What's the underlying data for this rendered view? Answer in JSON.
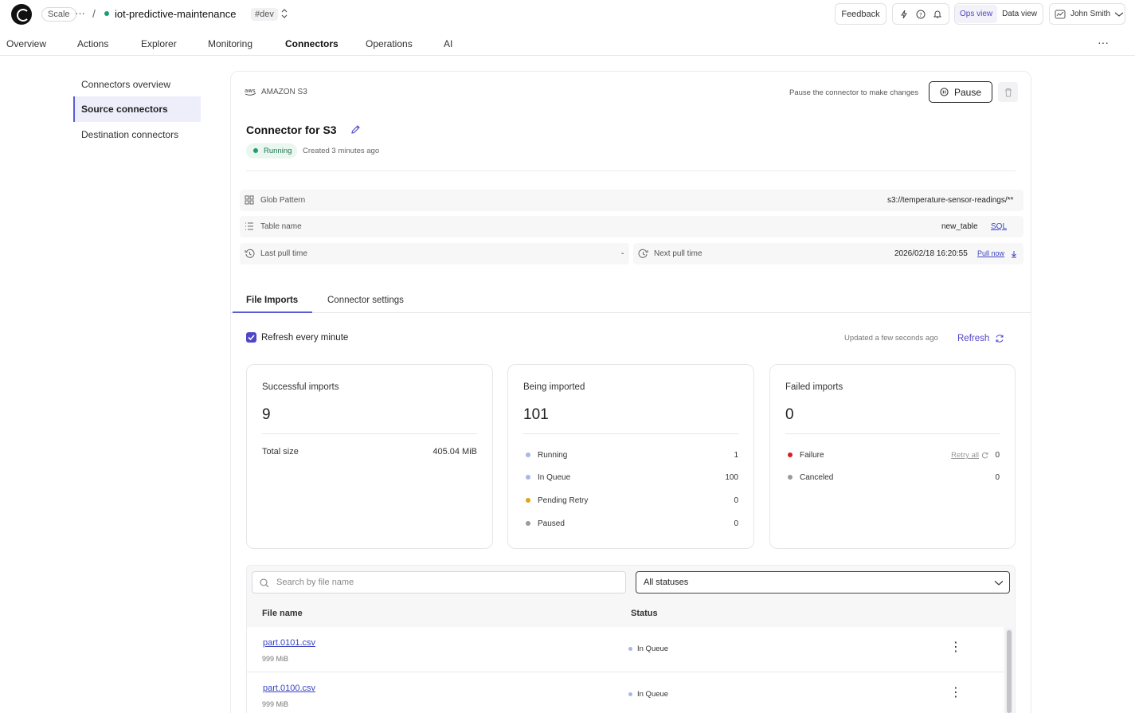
{
  "header": {
    "plan": "Scale",
    "more": "···",
    "sep": "/",
    "project": "iot-predictive-maintenance",
    "env": "#dev",
    "feedback": "Feedback",
    "ops_view": "Ops view",
    "data_view": "Data view",
    "user": "John Smith"
  },
  "nav": {
    "tabs": [
      "Overview",
      "Actions",
      "Explorer",
      "Monitoring",
      "Connectors",
      "Operations",
      "AI"
    ],
    "active": "Connectors",
    "more": "···"
  },
  "sidebar": {
    "items": [
      "Connectors overview",
      "Source connectors",
      "Destination connectors"
    ]
  },
  "connector": {
    "type": "AMAZON S3",
    "pause_hint": "Pause the connector to make changes",
    "pause_label": "Pause",
    "name": "Connector for S3",
    "status": "Running",
    "created": "Created 3 minutes ago",
    "glob_label": "Glob Pattern",
    "glob_value": "s3://temperature-sensor-readings/**",
    "table_label": "Table name",
    "table_value": "new_table",
    "sql_link": "SQL",
    "last_pull_label": "Last pull time",
    "last_pull_value": "-",
    "next_pull_label": "Next pull time",
    "next_pull_value": "2026/02/18 16:20:55",
    "pull_now": "Pull now"
  },
  "tabs": {
    "file_imports": "File Imports",
    "settings": "Connector settings"
  },
  "refresh": {
    "checkbox_label": "Refresh every minute",
    "updated": "Updated a few seconds ago",
    "button": "Refresh"
  },
  "stats": {
    "successful": {
      "title": "Successful imports",
      "count": "9",
      "size_label": "Total size",
      "size_value": "405.04 MiB"
    },
    "being": {
      "title": "Being imported",
      "count": "101",
      "rows": [
        {
          "label": "Running",
          "count": "1",
          "color": "#a9b6e8"
        },
        {
          "label": "In Queue",
          "count": "100",
          "color": "#a9b6e8"
        },
        {
          "label": "Pending Retry",
          "count": "0",
          "color": "#e2a11b"
        },
        {
          "label": "Paused",
          "count": "0",
          "color": "#9a9aa3"
        }
      ]
    },
    "failed": {
      "title": "Failed imports",
      "count": "0",
      "retry_all": "Retry all",
      "rows": [
        {
          "label": "Failure",
          "count": "0",
          "color": "#d42020"
        },
        {
          "label": "Canceled",
          "count": "0",
          "color": "#9a9aa3"
        }
      ]
    }
  },
  "filters": {
    "search_placeholder": "Search by file name",
    "status_select": "All statuses"
  },
  "table": {
    "col_file": "File name",
    "col_status": "Status",
    "rows": [
      {
        "name": "part.0101.csv",
        "size": "999 MiB",
        "status": "In Queue"
      },
      {
        "name": "part.0100.csv",
        "size": "999 MiB",
        "status": "In Queue"
      }
    ]
  }
}
